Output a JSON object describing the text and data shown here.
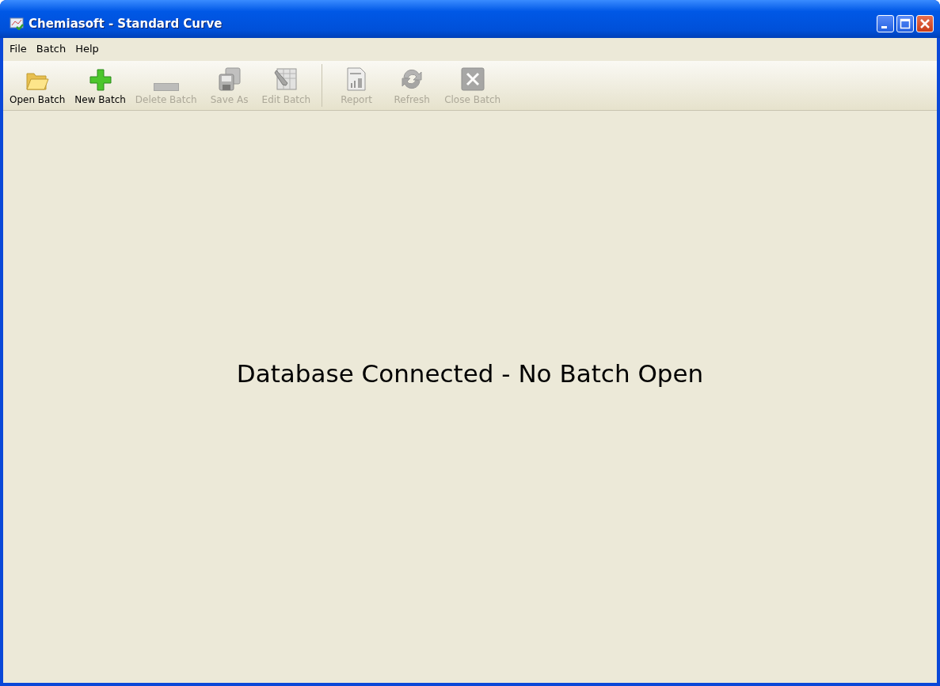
{
  "window": {
    "title": "Chemiasoft - Standard Curve"
  },
  "menu": [
    "File",
    "Batch",
    "Help"
  ],
  "toolbar": {
    "groups": [
      [
        {
          "label": "Open Batch",
          "kind": "open",
          "disabled": false
        },
        {
          "label": "New Batch",
          "kind": "new",
          "disabled": false
        },
        {
          "label": "Delete Batch",
          "kind": "delete",
          "disabled": true
        },
        {
          "label": "Save As",
          "kind": "save",
          "disabled": true
        },
        {
          "label": "Edit Batch",
          "kind": "edit",
          "disabled": true
        }
      ],
      [
        {
          "label": "Report",
          "kind": "report",
          "disabled": true
        },
        {
          "label": "Refresh",
          "kind": "refresh",
          "disabled": true
        },
        {
          "label": "Close Batch",
          "kind": "close",
          "disabled": true
        }
      ]
    ]
  },
  "status_message": "Database Connected - No Batch Open"
}
